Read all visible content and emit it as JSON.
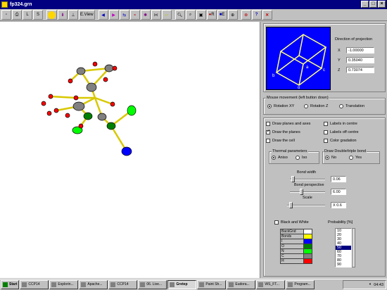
{
  "window": {
    "title": "fp324.grn",
    "buttons": [
      "_",
      "□",
      "×"
    ]
  },
  "toolbar": {
    "view_label": "E.View",
    "r_label": "R",
    "e_label": "E",
    "l_label": "L",
    "s_label": "S"
  },
  "projection": {
    "title": "Direction of projection",
    "x_label": "X",
    "x_value": "-1.00000",
    "y_label": "Y",
    "y_value": "0.35040",
    "z_label": "Z",
    "z_value": "0.73074",
    "axis_labels": [
      "a",
      "b",
      "c",
      "o"
    ]
  },
  "mouse": {
    "group_label": "Mouse movement (left button down)",
    "options": [
      "Rotation XY",
      "Rotation Z",
      "Translation"
    ],
    "selected": "Rotation XY"
  },
  "checks": {
    "draw_planes_axes": "Draw planes and axes",
    "draw_planes": "Draw the planes",
    "draw_cell": "Draw the cell",
    "labels_centre": "Labels in centre",
    "labels_off": "Labels off centre",
    "colour_gradation": "Color gradation"
  },
  "thermal": {
    "label": "Thermal parameters",
    "anisotropic": "Aniso",
    "isotropic": "Iso"
  },
  "bond_draw": {
    "label": "Draw Double/triple bond",
    "no": "No",
    "yes": "Yes"
  },
  "bond_width": {
    "label": "Bond width",
    "value": "0.06"
  },
  "bond_perspective": {
    "label": "Bond perspective",
    "value": "6.00"
  },
  "scale": {
    "label": "Scale",
    "value": "X 0.6"
  },
  "black_white": "Black and White",
  "colour_table": {
    "rows": [
      {
        "label": "BackGnd",
        "color": "#ffffff"
      },
      {
        "label": "Bonds",
        "color": "#ffff00"
      },
      {
        "label": "I",
        "color": "#0000ff"
      },
      {
        "label": "O",
        "color": "#008000"
      },
      {
        "label": "N",
        "color": "#00ff00"
      },
      {
        "label": "C",
        "color": "#808080"
      },
      {
        "label": "H",
        "color": "#ff0000"
      }
    ]
  },
  "probability": {
    "label": "Probability [%]",
    "options": [
      "10",
      "20",
      "30",
      "40",
      "50",
      "60",
      "70",
      "80",
      "90"
    ],
    "selected": "50"
  },
  "taskbar": {
    "start": "Start",
    "tasks": [
      "CCP14",
      "Explorin...",
      "Apache...",
      "CCP14",
      "06. Live...",
      "Gretep",
      "Paint Sh...",
      "Eudora...",
      "WS_FT...",
      "Program..."
    ],
    "active": "Gretep",
    "time": "04:43"
  },
  "colors": {
    "title_bar": "#000080",
    "canvas": "#ffffff",
    "projection_bg": "#0000ff",
    "cube": "#ffff80"
  }
}
